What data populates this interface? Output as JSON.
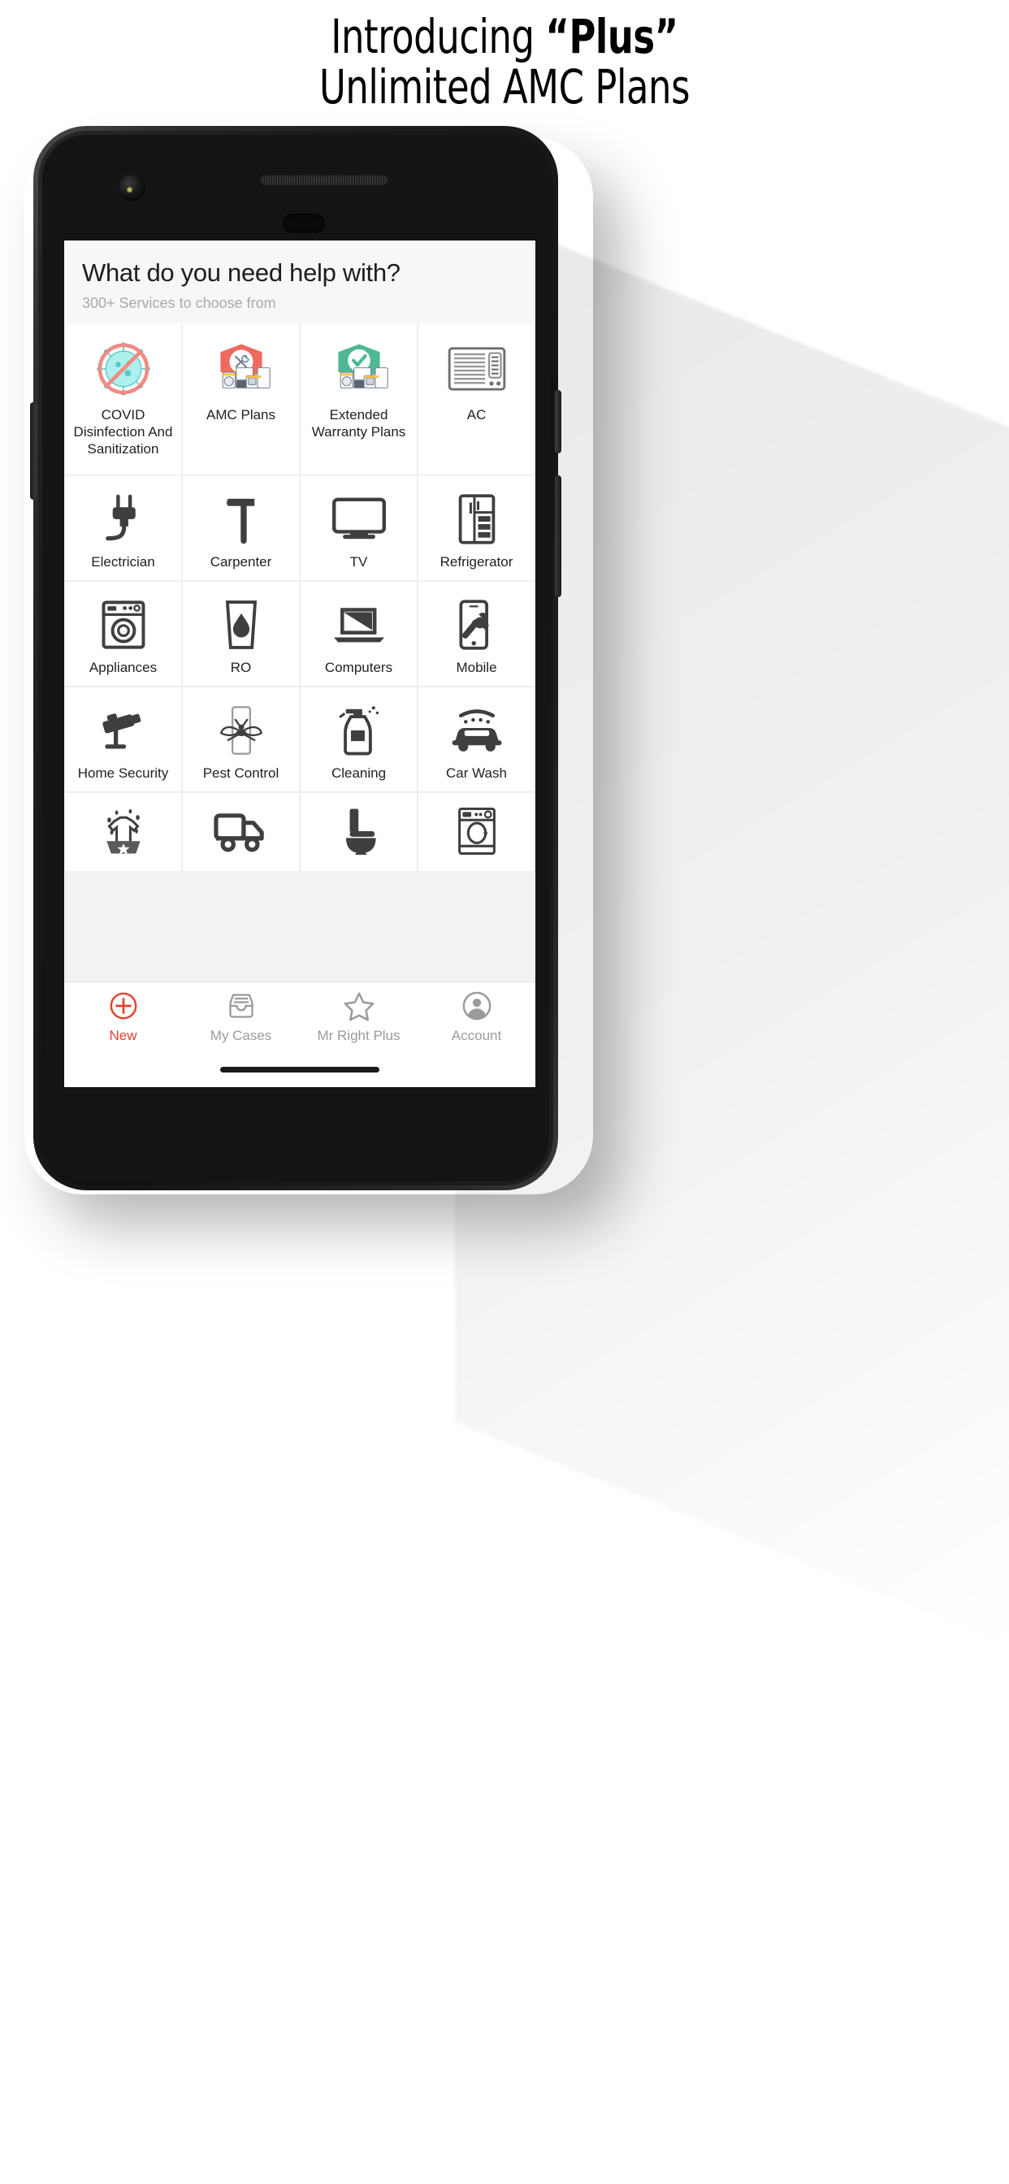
{
  "headline": {
    "line1_prefix": "Introducing ",
    "line1_strong": "“Plus”",
    "line2": "Unlimited AMC Plans"
  },
  "app": {
    "title": "What do you need help with?",
    "subtitle": "300+ Services to choose from"
  },
  "services": [
    {
      "label": "COVID Disinfection And Sanitization",
      "icon": "covid-virus-blocked-icon"
    },
    {
      "label": "AMC Plans",
      "icon": "red-shield-tools-appliances-icon"
    },
    {
      "label": "Extended Warranty Plans",
      "icon": "green-shield-check-appliances-icon"
    },
    {
      "label": "AC",
      "icon": "window-air-conditioner-icon"
    },
    {
      "label": "Electrician",
      "icon": "power-plug-icon"
    },
    {
      "label": "Carpenter",
      "icon": "hammer-icon"
    },
    {
      "label": "TV",
      "icon": "television-icon"
    },
    {
      "label": "Refrigerator",
      "icon": "refrigerator-icon"
    },
    {
      "label": "Appliances",
      "icon": "washing-machine-icon"
    },
    {
      "label": "RO",
      "icon": "water-glass-drop-icon"
    },
    {
      "label": "Computers",
      "icon": "laptop-icon"
    },
    {
      "label": "Mobile",
      "icon": "mobile-wrench-icon"
    },
    {
      "label": "Home Security",
      "icon": "cctv-camera-icon"
    },
    {
      "label": "Pest Control",
      "icon": "mosquito-icon"
    },
    {
      "label": "Cleaning",
      "icon": "spray-bottle-icon"
    },
    {
      "label": "Car Wash",
      "icon": "car-wash-icon"
    },
    {
      "label": "",
      "icon": "laundry-basket-icon"
    },
    {
      "label": "",
      "icon": "delivery-truck-icon"
    },
    {
      "label": "",
      "icon": "toilet-icon"
    },
    {
      "label": "",
      "icon": "washing-machine-top-icon"
    }
  ],
  "bottom_nav": [
    {
      "label": "New",
      "icon": "plus-circle-icon",
      "active": true
    },
    {
      "label": "My Cases",
      "icon": "inbox-tray-icon",
      "active": false
    },
    {
      "label": "Mr Right Plus",
      "icon": "star-outline-icon",
      "active": false
    },
    {
      "label": "Account",
      "icon": "account-avatar-icon",
      "active": false
    }
  ],
  "colors": {
    "accent_red": "#e0412f",
    "amc_shield_red": "#ef6a5e",
    "warranty_shield_green": "#4fb893",
    "covid_ring_pink": "#f08b84",
    "covid_virus_teal": "#7fe0dc",
    "nav_inactive_gray": "#9b9b9b",
    "subtitle_gray": "#aaaaaa",
    "icon_dark": "#3f3f3f"
  }
}
